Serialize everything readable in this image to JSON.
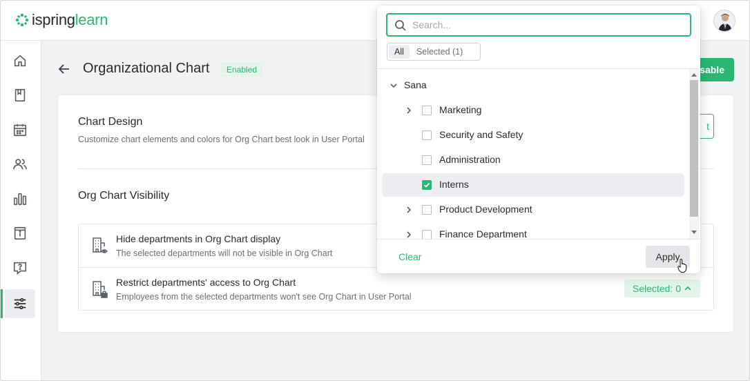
{
  "app": {
    "logo_text_main": "ispring",
    "logo_text_accent": "learn",
    "brand_color": "#2bb673"
  },
  "sidebar": {
    "items": [
      {
        "icon": "home-icon"
      },
      {
        "icon": "book-icon"
      },
      {
        "icon": "calendar-icon"
      },
      {
        "icon": "users-icon"
      },
      {
        "icon": "reports-icon"
      },
      {
        "icon": "info-icon"
      },
      {
        "icon": "help-icon"
      },
      {
        "icon": "settings-sliders-icon",
        "active": true
      }
    ]
  },
  "header": {
    "title": "Organizational Chart",
    "status_badge": "Enabled",
    "primary_button": "isable"
  },
  "card": {
    "design_title": "Chart Design",
    "design_subtitle": "Customize chart elements and colors for Org Chart best look in User Portal",
    "edit_button_partial": "t",
    "visibility_title": "Org Chart Visibility",
    "rows": [
      {
        "title": "Hide departments in Org Chart display",
        "subtitle": "The selected departments will not be visible in Org Chart"
      },
      {
        "title": "Restrict departments' access to Org Chart",
        "subtitle": "Employees from the selected departments won't see Org Chart in User Portal",
        "selected_label": "Selected:",
        "selected_count": "0"
      }
    ]
  },
  "dropdown": {
    "search_placeholder": "Search...",
    "tabs": [
      "All",
      "Selected (1)"
    ],
    "active_tab": "All",
    "root": "Sana",
    "items": [
      {
        "label": "Marketing",
        "expandable": true,
        "checked": false
      },
      {
        "label": "Security and Safety",
        "expandable": false,
        "checked": false
      },
      {
        "label": "Administration",
        "expandable": false,
        "checked": false
      },
      {
        "label": "Interns",
        "expandable": false,
        "checked": true
      },
      {
        "label": "Product Development",
        "expandable": true,
        "checked": false
      },
      {
        "label": "Finance Department",
        "expandable": true,
        "checked": false
      }
    ],
    "clear_label": "Clear",
    "apply_label": "Apply"
  }
}
